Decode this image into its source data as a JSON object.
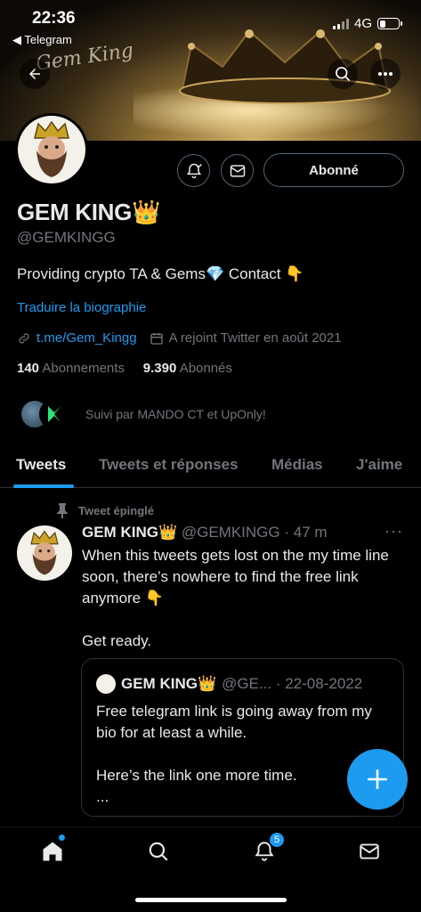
{
  "status_bar": {
    "time": "22:36",
    "back_app": "◀ Telegram",
    "network": "4G",
    "battery_level": 0.3
  },
  "banner": {
    "script_text": "Gem King"
  },
  "profile": {
    "name": "GEM KING👑",
    "handle": "@GEMKINGG",
    "bio": "Providing crypto TA & Gems💎 Contact 👇",
    "translate_label": "Traduire la biographie",
    "link": "t.me/Gem_Kingg",
    "joined": "A rejoint Twitter en août 2021",
    "following_count": "140",
    "following_label": "Abonnements",
    "followers_count": "9.390",
    "followers_label": "Abonnés",
    "followed_by": "Suivi par MANDO CT et UpOnly!",
    "follow_button": "Abonné"
  },
  "tabs": [
    {
      "label": "Tweets",
      "active": true
    },
    {
      "label": "Tweets et réponses",
      "active": false
    },
    {
      "label": "Médias",
      "active": false
    },
    {
      "label": "J'aime",
      "active": false
    }
  ],
  "pinned_tweet": {
    "pin_label": "Tweet épinglé",
    "author": "GEM KING👑",
    "meta": "@GEMKINGG · 47 m",
    "text": "When this tweets gets lost on the my time line soon, there’s nowhere to find the free link anymore 👇\n\nGet ready.",
    "quote": {
      "author": "GEM KING👑",
      "meta": "@GE... · 22-08-2022",
      "text": "Free telegram link is going away from my bio for at least a while.\n\nHere’s the link one more time.\n..."
    }
  },
  "nav": {
    "notifications_badge": "5"
  },
  "colors": {
    "accent": "#1d9bf0",
    "background": "#000000",
    "secondary_text": "#71767b"
  }
}
